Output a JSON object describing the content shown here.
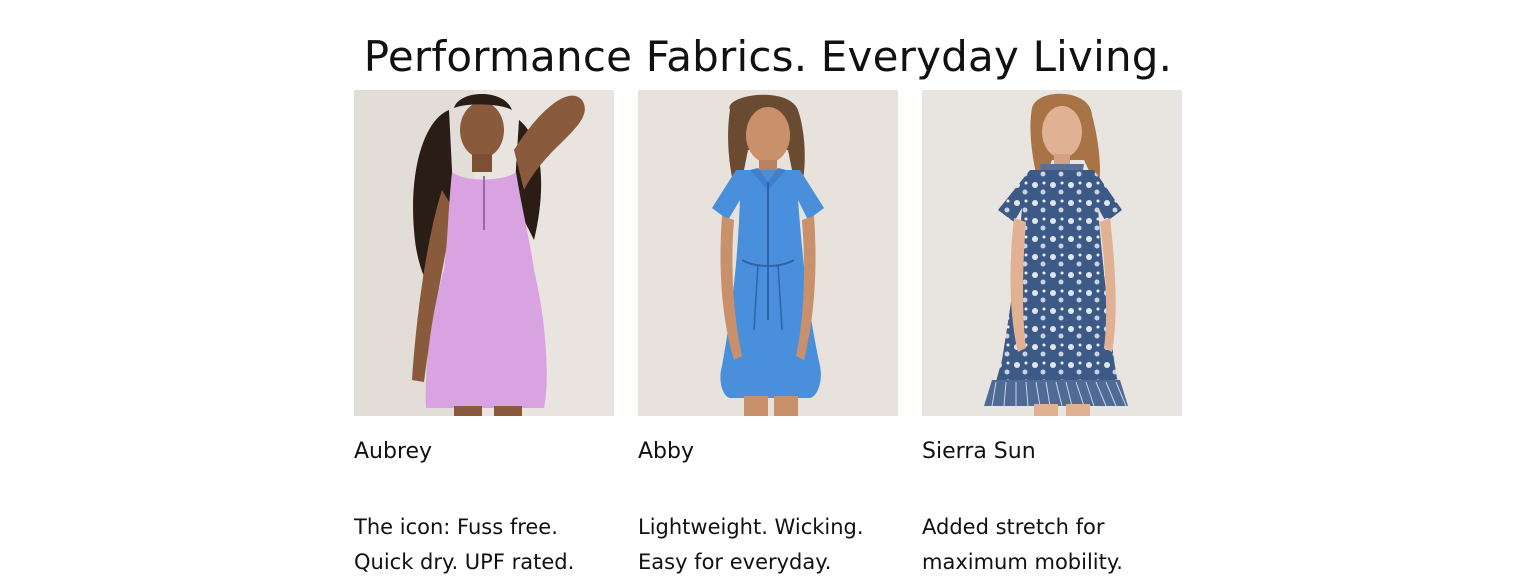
{
  "headline": "Performance Fabrics. Everyday Living.",
  "products": [
    {
      "name": "Aubrey",
      "description_lines": [
        "The icon: Fuss free.",
        "Quick dry. UPF rated."
      ],
      "dress_color": "#d9a3e2",
      "photo_icon": "model-in-lavender-dress-image"
    },
    {
      "name": "Abby",
      "description_lines": [
        "Lightweight. Wicking.",
        "Easy for everyday."
      ],
      "dress_color": "#4a8fdc",
      "photo_icon": "model-in-blue-polo-dress-image"
    },
    {
      "name": "Sierra Sun",
      "description_lines": [
        "Added stretch for",
        "maximum mobility."
      ],
      "dress_color": "#3d5a86",
      "photo_icon": "model-in-navy-floral-dress-image"
    }
  ],
  "colors": {
    "text": "#111111",
    "photo_background": "#e6e1dc"
  }
}
